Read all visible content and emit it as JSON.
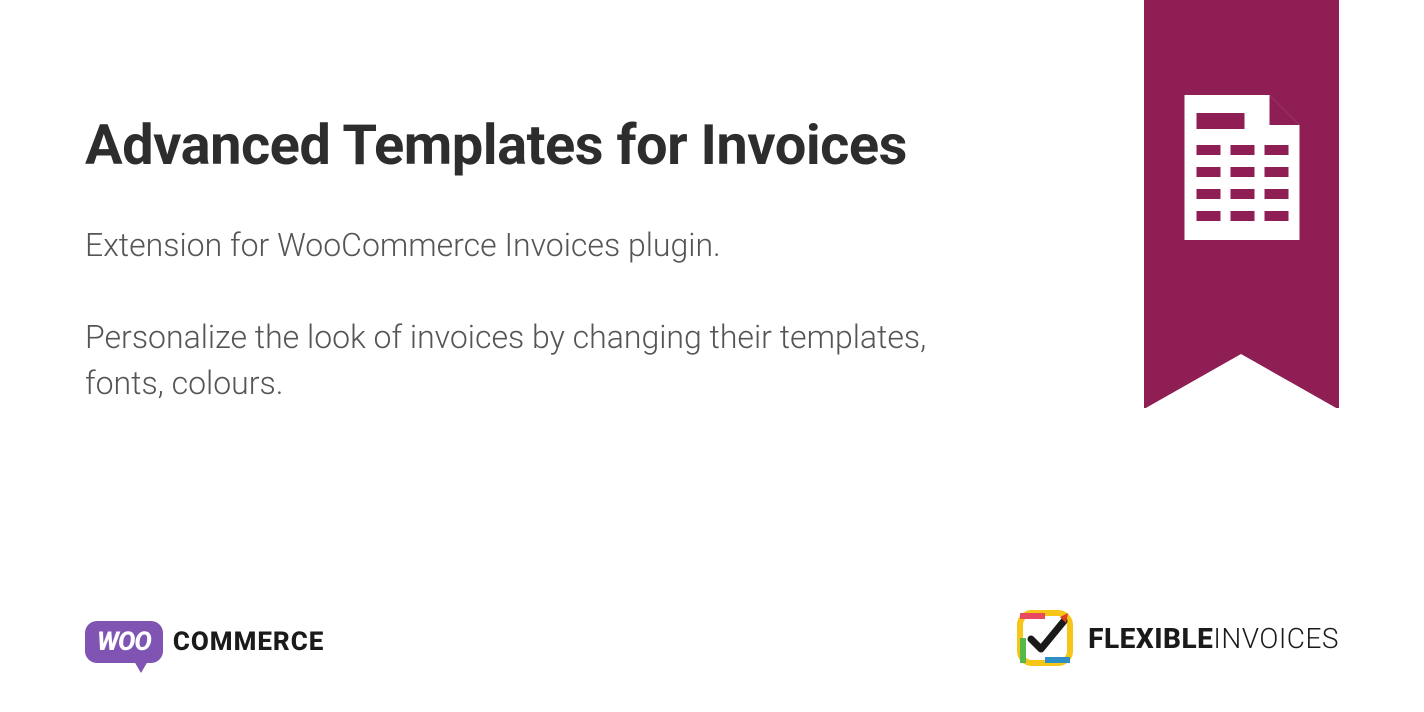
{
  "title": "Advanced Templates for Invoices",
  "description": {
    "line1": "Extension for WooCommerce Invoices plugin.",
    "line2": "Personalize the look of invoices by changing their templates, fonts, colours."
  },
  "logos": {
    "woo_prefix": "WOO",
    "woo_suffix": "COMMERCE",
    "flexible_prefix": "FLEXIBLE",
    "flexible_suffix": "INVOICES"
  },
  "colors": {
    "ribbon": "#8e1e54",
    "woo": "#7f54b3"
  }
}
